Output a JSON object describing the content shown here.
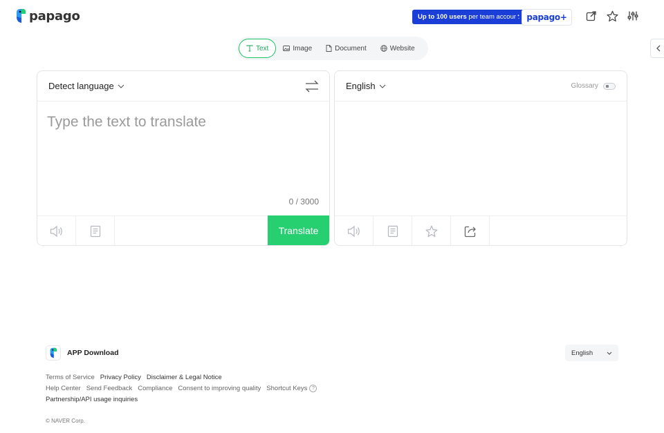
{
  "header": {
    "logo_text": "papago",
    "promo_bold": "Up to 100 users",
    "promo_rest": " per team account",
    "plus_label": "papago+",
    "icons": [
      "share-window-icon",
      "star-icon",
      "settings-sliders-icon"
    ]
  },
  "modes": [
    {
      "label": "Text",
      "icon": "text-icon",
      "active": true
    },
    {
      "label": "Image",
      "icon": "image-icon"
    },
    {
      "label": "Document",
      "icon": "document-icon"
    },
    {
      "label": "Website",
      "icon": "globe-icon"
    }
  ],
  "source": {
    "language": "Detect language",
    "placeholder": "Type the text to translate",
    "counter": "0 / 3000",
    "translate_label": "Translate"
  },
  "target": {
    "language": "English",
    "glossary_label": "Glossary"
  },
  "footer": {
    "app_download": "APP Download",
    "language": "English",
    "links_row1": [
      "Terms of Service",
      "Privacy Policy",
      "Disclaimer & Legal Notice"
    ],
    "links_row2": [
      "Help Center",
      "Send Feedback",
      "Compliance",
      "Consent to improving quality",
      "Shortcut Keys"
    ],
    "links_row3": [
      "Partnership/API usage inquiries"
    ],
    "help_glyph": "?",
    "copyright": "© NAVER Corp."
  },
  "colors": {
    "brand_green": "#26cf70",
    "brand_blue": "#1a3ed6"
  }
}
